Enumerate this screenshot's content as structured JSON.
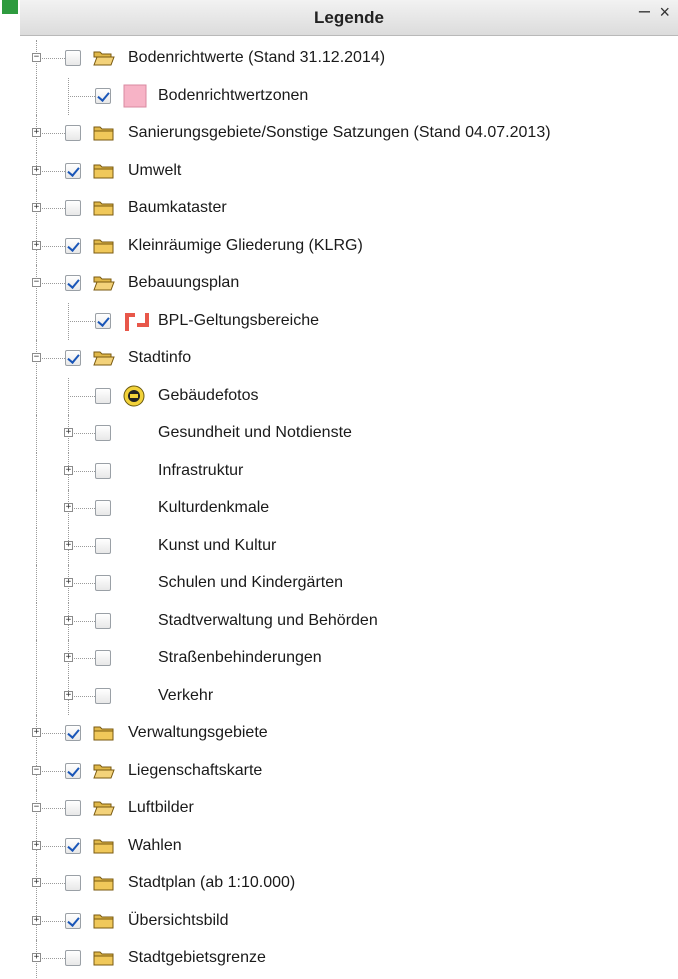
{
  "panel": {
    "title": "Legende",
    "minimize_glyph": "–",
    "close_glyph": "×"
  },
  "items": [
    {
      "label": "Bodenrichtwerte (Stand 31.12.2014)",
      "level": 0,
      "expander": "minus",
      "checked": false,
      "icon": "folder-open-icon"
    },
    {
      "label": "Bodenrichtwertzonen",
      "level": 1,
      "expander": "none",
      "checked": true,
      "icon": "pink-swatch-icon"
    },
    {
      "label": "Sanierungsgebiete/Sonstige Satzungen (Stand 04.07.2013)",
      "level": 0,
      "expander": "plus",
      "checked": false,
      "icon": "folder-closed-icon"
    },
    {
      "label": "Umwelt",
      "level": 0,
      "expander": "plus",
      "checked": true,
      "icon": "folder-closed-icon"
    },
    {
      "label": "Baumkataster",
      "level": 0,
      "expander": "plus",
      "checked": false,
      "icon": "folder-closed-icon"
    },
    {
      "label": "Kleinräumige Gliederung (KLRG)",
      "level": 0,
      "expander": "plus",
      "checked": true,
      "icon": "folder-closed-icon"
    },
    {
      "label": "Bebauungsplan",
      "level": 0,
      "expander": "minus",
      "checked": true,
      "icon": "folder-open-icon"
    },
    {
      "label": "BPL-Geltungsbereiche",
      "level": 1,
      "expander": "none",
      "checked": true,
      "icon": "bpl-corner-icon"
    },
    {
      "label": "Stadtinfo",
      "level": 0,
      "expander": "minus",
      "checked": true,
      "icon": "folder-open-icon"
    },
    {
      "label": "Gebäudefotos",
      "level": 1,
      "expander": "none",
      "checked": false,
      "icon": "photo-badge-icon"
    },
    {
      "label": "Gesundheit und Notdienste",
      "level": 1,
      "expander": "plus",
      "checked": false,
      "icon": "none"
    },
    {
      "label": "Infrastruktur",
      "level": 1,
      "expander": "plus",
      "checked": false,
      "icon": "none"
    },
    {
      "label": "Kulturdenkmale",
      "level": 1,
      "expander": "plus",
      "checked": false,
      "icon": "none"
    },
    {
      "label": "Kunst und Kultur",
      "level": 1,
      "expander": "plus",
      "checked": false,
      "icon": "none"
    },
    {
      "label": "Schulen und Kindergärten",
      "level": 1,
      "expander": "plus",
      "checked": false,
      "icon": "none"
    },
    {
      "label": "Stadtverwaltung und Behörden",
      "level": 1,
      "expander": "plus",
      "checked": false,
      "icon": "none"
    },
    {
      "label": "Straßenbehinderungen",
      "level": 1,
      "expander": "plus",
      "checked": false,
      "icon": "none"
    },
    {
      "label": "Verkehr",
      "level": 1,
      "expander": "plus",
      "checked": false,
      "icon": "none"
    },
    {
      "label": "Verwaltungsgebiete",
      "level": 0,
      "expander": "plus",
      "checked": true,
      "icon": "folder-closed-icon"
    },
    {
      "label": "Liegenschaftskarte",
      "level": 0,
      "expander": "minus",
      "checked": true,
      "icon": "folder-open-icon"
    },
    {
      "label": "Luftbilder",
      "level": 0,
      "expander": "minus",
      "checked": false,
      "icon": "folder-open-icon"
    },
    {
      "label": "Wahlen",
      "level": 0,
      "expander": "plus",
      "checked": true,
      "icon": "folder-closed-icon"
    },
    {
      "label": "Stadtplan (ab 1:10.000)",
      "level": 0,
      "expander": "plus",
      "checked": false,
      "icon": "folder-closed-icon"
    },
    {
      "label": "Übersichtsbild",
      "level": 0,
      "expander": "plus",
      "checked": true,
      "icon": "folder-closed-icon"
    },
    {
      "label": "Stadtgebietsgrenze",
      "level": 0,
      "expander": "plus",
      "checked": false,
      "icon": "folder-closed-icon"
    }
  ],
  "colors": {
    "folder": "#e0b84a",
    "checkmark": "#1a56b8",
    "swatch": "#f7b3c6",
    "bpl_icon": "#e8574a"
  }
}
